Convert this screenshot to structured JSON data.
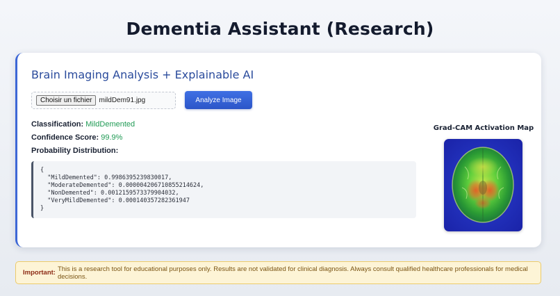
{
  "header": {
    "title": "Dementia Assistant (Research)"
  },
  "card": {
    "title": "Brain Imaging Analysis + Explainable AI",
    "file_input": {
      "button_label": "Choisir un fichier",
      "file_name": "mildDem91.jpg"
    },
    "analyze_button_label": "Analyze Image",
    "classification_label": "Classification:",
    "classification_value": "MildDemented",
    "confidence_label": "Confidence Score:",
    "confidence_value": "99.9%",
    "probability_label": "Probability Distribution:",
    "probability_json": "{\n  \"MildDemented\": 0.9986395239830017,\n  \"ModerateDemented\": 0.000004206710855214624,\n  \"NonDemented\": 0.0012159573379904032,\n  \"VeryMildDemented\": 0.000140357282361947\n}",
    "gradcam_title": "Grad-CAM Activation Map"
  },
  "notice": {
    "label": "Important:",
    "text": "This is a research tool for educational purposes only. Results are not validated for clinical diagnosis. Always consult qualified healthcare professionals for medical decisions."
  },
  "colors": {
    "accent": "#3d67d6",
    "success": "#1f9a54",
    "warning_bg": "#fdf4d6"
  }
}
